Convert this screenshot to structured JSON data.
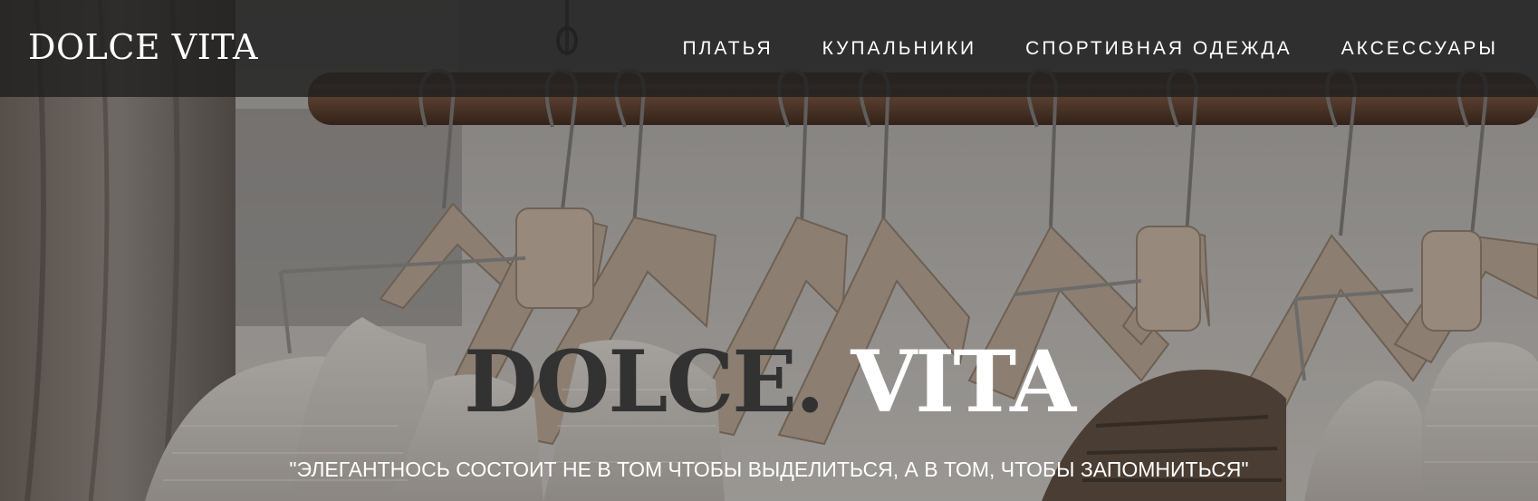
{
  "header": {
    "logo": "DOLCE VITA",
    "nav": [
      {
        "label": "ПЛАТЬЯ"
      },
      {
        "label": "КУПАЛЬНИКИ"
      },
      {
        "label": "СПОРТИВНАЯ ОДЕЖДА"
      },
      {
        "label": "АКСЕССУАРЫ"
      }
    ]
  },
  "hero": {
    "title_dark": "DOLCE.",
    "title_light": "VITA",
    "tagline": "\"ЭЛЕГАНТНОСЬ СОСТОИТ НЕ В ТОМ ЧТОБЫ ВЫДЕЛИТЬСЯ, А В ТОМ, ЧТОБЫ ЗАПОМНИТЬСЯ\""
  },
  "colors": {
    "header_bg": "#202020",
    "text_light": "#ffffff",
    "title_dark": "#333232"
  }
}
